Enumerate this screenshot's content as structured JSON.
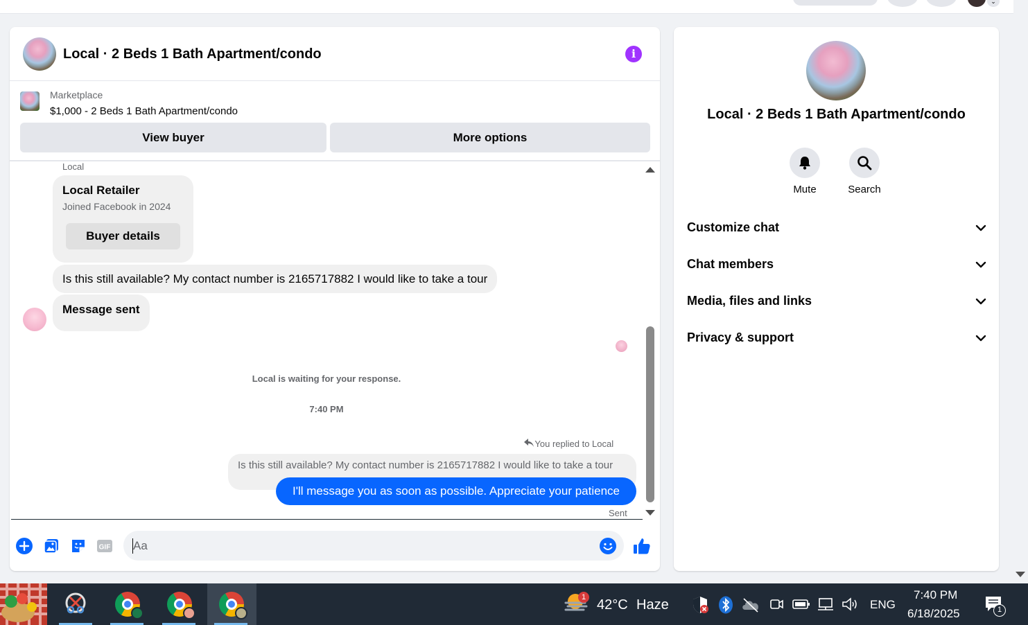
{
  "header": {
    "title": "Local · 2 Beds 1 Bath Apartment/condo",
    "info_label": "i"
  },
  "marketplace": {
    "label": "Marketplace",
    "listing": "$1,000 - 2 Beds 1 Bath Apartment/condo",
    "view_buyer": "View buyer",
    "more_options": "More options"
  },
  "messages": {
    "sender_label": "Local",
    "card_name": "Local Retailer",
    "card_joined": "Joined Facebook in 2024",
    "card_button": "Buyer details",
    "incoming_1": "Is this still available? My contact number is 2165717882 I would like to take a tour",
    "incoming_2": "Message sent",
    "waiting_note": "Local is waiting for your response.",
    "timestamp": "7:40 PM",
    "replied_note": "You replied to Local",
    "quoted": "Is this still available? My contact number is 2165717882 I would like to take a tour",
    "outgoing": "I'll message you as soon as possible. Appreciate your patience",
    "status": "Sent"
  },
  "composer": {
    "placeholder": "Aa",
    "gif_label": "GIF"
  },
  "side": {
    "title": "Local · 2 Beds 1 Bath Apartment/condo",
    "actions": [
      {
        "label": "Mute",
        "icon": "bell-icon"
      },
      {
        "label": "Search",
        "icon": "search-icon"
      }
    ],
    "sections": [
      {
        "label": "Customize chat"
      },
      {
        "label": "Chat members"
      },
      {
        "label": "Media, files and links"
      },
      {
        "label": "Privacy & support"
      }
    ]
  },
  "taskbar": {
    "weather_temp": "42°C",
    "weather_desc": "Haze",
    "weather_badge": "1",
    "language": "ENG",
    "time": "7:40 PM",
    "date": "6/18/2025",
    "notification_count": "1"
  },
  "colors": {
    "accent": "#0866ff",
    "info": "#a033ff",
    "taskbar": "#202a36"
  }
}
